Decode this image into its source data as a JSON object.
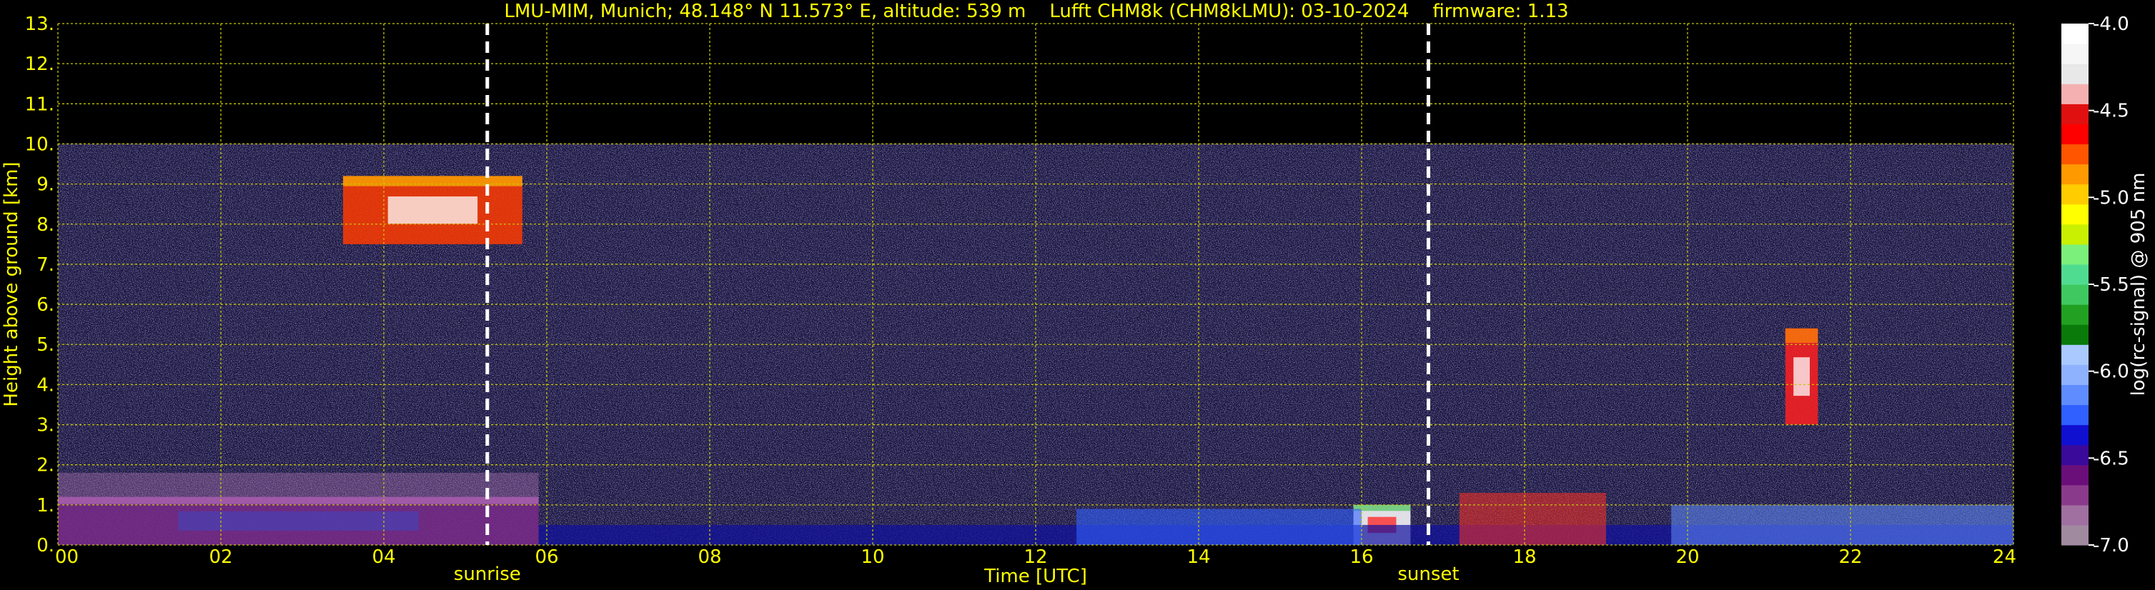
{
  "chart_data": {
    "type": "heatmap",
    "title": "LMU-MIM, Munich; 48.148° N 11.573° E, altitude: 539 m    Lufft CHM8k (CHM8kLMU): 03-10-2024    firmware: 1.13",
    "xlabel": "Time [UTC]",
    "ylabel": "Height above ground [km]",
    "xlim": [
      0,
      24
    ],
    "ylim": [
      0,
      13
    ],
    "x_ticks": [
      "00",
      "02",
      "04",
      "06",
      "08",
      "10",
      "12",
      "14",
      "16",
      "18",
      "20",
      "22",
      "24"
    ],
    "y_ticks": [
      "0.",
      "1.",
      "2.",
      "3.",
      "4.",
      "5.",
      "6.",
      "7.",
      "8.",
      "9.",
      "10.",
      "11.",
      "12.",
      "13."
    ],
    "grid": true,
    "data_top_km": 10,
    "markers": [
      {
        "label": "sunrise",
        "time_h": 5.27
      },
      {
        "label": "sunset",
        "time_h": 16.82
      }
    ],
    "colorbar": {
      "label": "log(rc-signal) @ 905 nm",
      "range": [
        -7.0,
        -4.0
      ],
      "ticks": [
        "-4.0",
        "-4.5",
        "-5.0",
        "-5.5",
        "-6.0",
        "-6.5",
        "-7.0"
      ],
      "colors": [
        "#a08aa0",
        "#a070a0",
        "#8a3a8a",
        "#6a0f7a",
        "#3a0a9a",
        "#1010d0",
        "#3060ff",
        "#5f8cff",
        "#8fb2ff",
        "#a9c9ff",
        "#0a7a0a",
        "#22a022",
        "#40c860",
        "#50dc90",
        "#7bf07b",
        "#c8f000",
        "#ffff00",
        "#ffcc00",
        "#ff9900",
        "#ff5500",
        "#ff0000",
        "#e01010",
        "#f4b0b0",
        "#e8e8e8",
        "#f6f6f6",
        "#ffffff"
      ]
    },
    "features": [
      {
        "name": "boundary layer aerosol (night)",
        "t0": 0.0,
        "t1": 5.9,
        "h0": 0.0,
        "h1": 1.2
      },
      {
        "name": "cirrus cloud",
        "t0": 3.5,
        "t1": 5.7,
        "h0": 7.5,
        "h1": 9.2
      },
      {
        "name": "afternoon low cloud",
        "t0": 15.9,
        "t1": 16.6,
        "h0": 0.0,
        "h1": 1.0
      },
      {
        "name": "convective cloud",
        "t0": 21.2,
        "t1": 21.6,
        "h0": 3.0,
        "h1": 5.4
      }
    ]
  }
}
